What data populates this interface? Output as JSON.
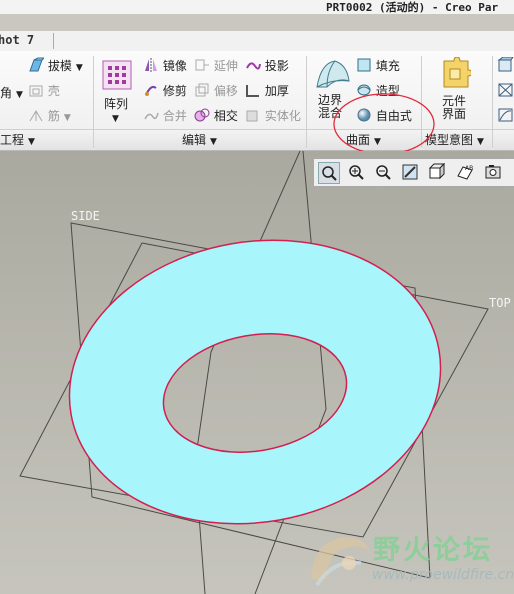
{
  "window": {
    "title": "PRT0002 (活动的) - Creo Par"
  },
  "tab_row": {
    "tab_tail": "hot 7"
  },
  "ribbon": {
    "groups": [
      {
        "label": "工程"
      },
      {
        "label": "编辑"
      },
      {
        "label": "曲面"
      },
      {
        "label": "模型意图"
      }
    ],
    "engineering": {
      "draft": "拔模",
      "shell": "壳",
      "rib": "筋",
      "round_tail": "角"
    },
    "editing": {
      "pattern": "阵列",
      "mirror": "镜像",
      "extend": "延伸",
      "project": "投影",
      "trim": "修剪",
      "offset": "偏移",
      "thicken": "加厚",
      "merge": "合并",
      "intersect": "相交",
      "solidify": "实体化"
    },
    "surfaces": {
      "boundary_blend_line1": "边界",
      "boundary_blend_line2": "混合",
      "fill": "填充",
      "style": "造型",
      "freestyle": "自由式"
    },
    "model_intent": {
      "component_interface_line1": "元件",
      "component_interface_line2": "界面"
    }
  },
  "viewport": {
    "datum_labels": {
      "side": "SIDE",
      "top": "TOP"
    },
    "part_color": "#a8f6fb",
    "edge_color": "#d21f4f"
  },
  "view_toolbar": {
    "icons": [
      "zoom-fit-icon",
      "zoom-in-icon",
      "zoom-out-icon",
      "repaint-icon",
      "display-style-icon",
      "saved-views-icon",
      "datum-display-icon",
      "view-manager-icon"
    ]
  },
  "watermark": {
    "text": "野火论坛",
    "url": "www.proewildfire.cn"
  }
}
